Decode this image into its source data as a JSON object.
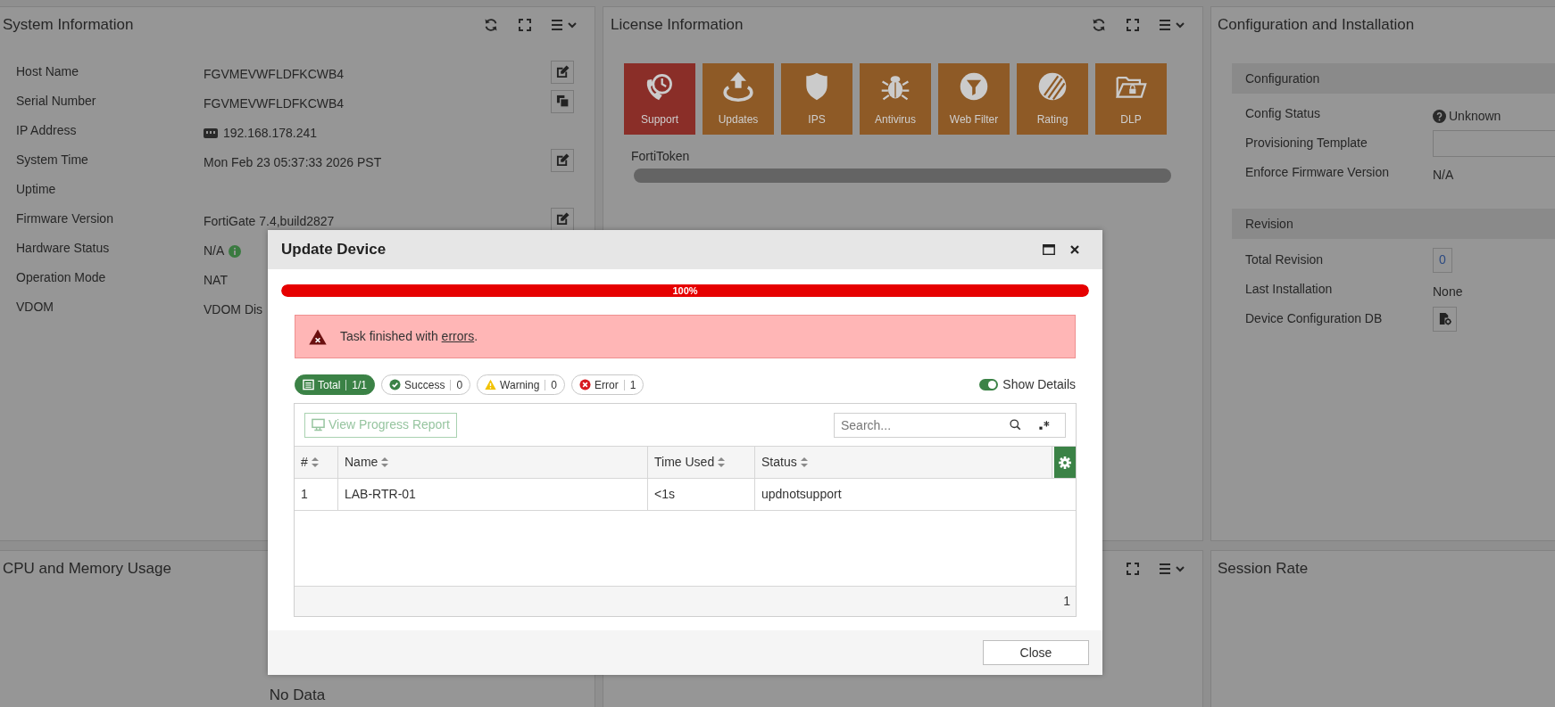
{
  "dashboard": {
    "rows": [
      {
        "panels": [
          {
            "title": "System Information",
            "tools": [
              {
                "kind": "refresh"
              },
              {
                "kind": "expand"
              },
              {
                "kind": "menu"
              }
            ],
            "rows": [
              {
                "kind": "editable",
                "label": "Host Name",
                "value": "FGVMEVWFLDFKCWB4"
              },
              {
                "kind": "copyable",
                "label": "Serial Number",
                "value": "FGVMEVWFLDFKCWB4"
              },
              {
                "kind": "address",
                "label": "IP Address",
                "value": "192.168.178.241"
              },
              {
                "kind": "editable",
                "label": "System Time",
                "value": "Mon Feb 23 05:37:33 2026 PST"
              },
              {
                "kind": "plain",
                "label": "Uptime"
              },
              {
                "kind": "editable",
                "label": "Firmware Version",
                "value": "FortiGate 7.4,build2827"
              },
              {
                "kind": "status",
                "label": "Hardware Status",
                "value": "N/A"
              },
              {
                "kind": "plain",
                "label": "Operation Mode",
                "value": "NAT"
              },
              {
                "kind": "plain",
                "label": "VDOM",
                "value": "VDOM Dis"
              }
            ]
          },
          {
            "title": "License Information",
            "tools": [
              {
                "kind": "refresh"
              },
              {
                "kind": "expand"
              },
              {
                "kind": "menu"
              }
            ],
            "tiles": [
              {
                "label": "Support",
                "color": "#8a2e28"
              },
              {
                "label": "Updates",
                "color": "#8e5a26"
              },
              {
                "label": "IPS",
                "color": "#8e5a26"
              },
              {
                "label": "Antivirus",
                "color": "#8e5a26"
              },
              {
                "label": "Web Filter",
                "color": "#8e5a26"
              },
              {
                "label": "Rating",
                "color": "#8e5a26"
              },
              {
                "label": "DLP",
                "color": "#8e5a26"
              }
            ],
            "token": {
              "label": "FortiToken"
            }
          },
          {
            "title": "Configuration and Installation",
            "sections": [
              {
                "title": "Configuration",
                "rows": [
                  {
                    "kind": "status",
                    "label": "Config Status",
                    "value": "Unknown"
                  },
                  {
                    "kind": "field",
                    "label": "Provisioning Template"
                  },
                  {
                    "kind": "text",
                    "label": "Enforce Firmware Version",
                    "value": "N/A"
                  }
                ]
              },
              {
                "title": "Revision",
                "rows": [
                  {
                    "kind": "count",
                    "label": "Total Revision",
                    "value": "0"
                  },
                  {
                    "kind": "text",
                    "label": "Last Installation",
                    "value": "None"
                  },
                  {
                    "kind": "button",
                    "label": "Device Configuration DB"
                  }
                ]
              }
            ]
          }
        ]
      },
      {
        "panels": [
          {
            "title": "CPU and Memory Usage",
            "message": "No Data"
          },
          {
            "tools": [
              {
                "kind": "expand"
              },
              {
                "kind": "menu"
              }
            ]
          },
          {
            "title": "Session Rate"
          }
        ]
      }
    ]
  },
  "dialog": {
    "title": "Update Device",
    "title_buttons": [
      {
        "kind": "maximize"
      },
      {
        "kind": "close"
      }
    ],
    "progress": {
      "level": 1,
      "label": "100%"
    },
    "alert": {
      "kind": "error",
      "text": "Task finished with ",
      "link": "errors",
      "text_after": "."
    },
    "filters": [
      {
        "kind": "total",
        "label": "Total",
        "count": "1/1",
        "selected": true
      },
      {
        "kind": "success",
        "label": "Success",
        "count": "0",
        "selected": false
      },
      {
        "kind": "warning",
        "label": "Warning",
        "count": "0",
        "selected": false
      },
      {
        "kind": "error",
        "label": "Error",
        "count": "1",
        "selected": false
      }
    ],
    "show_details": {
      "label": "Show Details",
      "on": true
    },
    "table": {
      "toolbar_button": {
        "label": "View Progress Report",
        "disabled": true
      },
      "search": {
        "placeholder": "Search..."
      },
      "columns": [
        {
          "label": "#"
        },
        {
          "label": "Name"
        },
        {
          "label": "Time Used"
        },
        {
          "label": "Status"
        }
      ],
      "rows": [
        [
          "1",
          "LAB-RTR-01",
          "<1s",
          "updnotsupport"
        ]
      ],
      "footer": "1"
    },
    "buttons": [
      {
        "label": "Close"
      }
    ]
  }
}
